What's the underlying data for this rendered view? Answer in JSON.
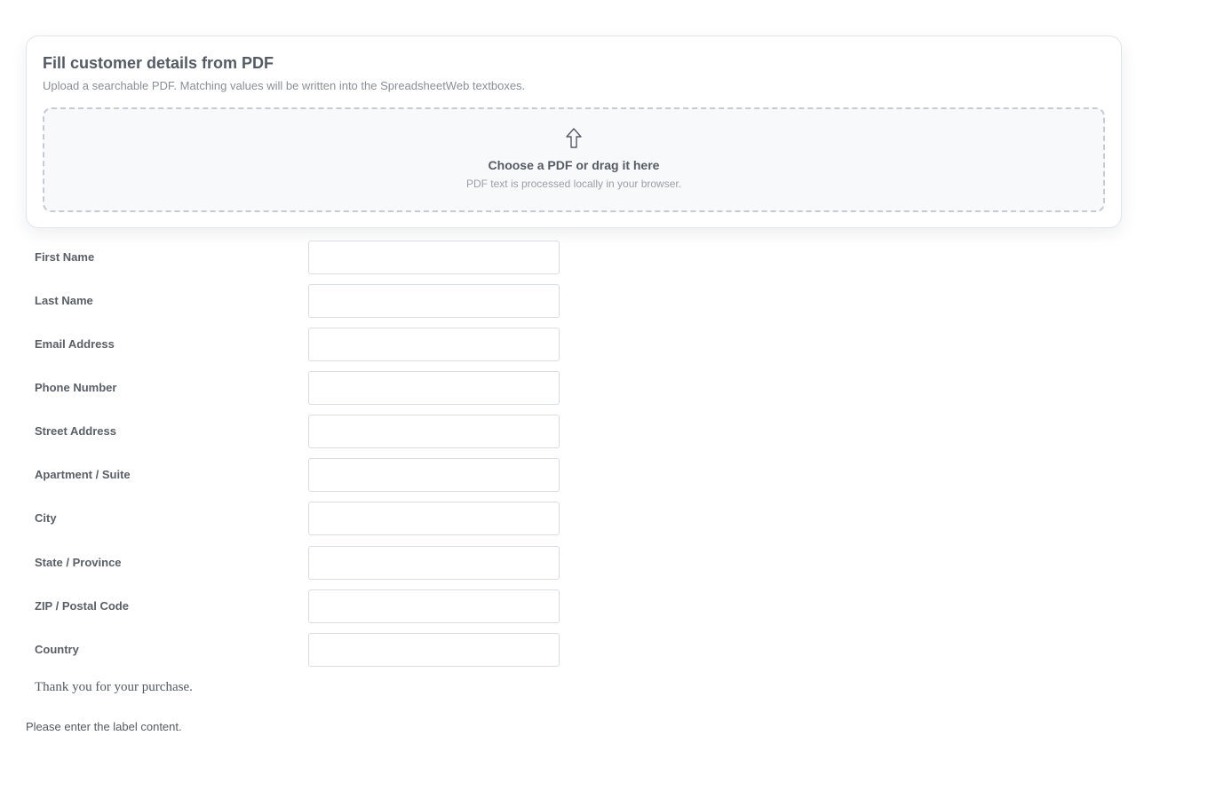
{
  "upload": {
    "title": "Fill customer details from PDF",
    "subtitle": "Upload a searchable PDF. Matching values will be written into the SpreadsheetWeb textboxes.",
    "icon": "upload-arrow-icon",
    "drop_title": "Choose a PDF or drag it here",
    "drop_note": "PDF text is processed locally in your browser."
  },
  "form": {
    "fields": [
      {
        "label": "First Name",
        "value": ""
      },
      {
        "label": "Last Name",
        "value": ""
      },
      {
        "label": "Email Address",
        "value": ""
      },
      {
        "label": "Phone Number",
        "value": ""
      },
      {
        "label": "Street Address",
        "value": ""
      },
      {
        "label": "Apartment / Suite",
        "value": ""
      },
      {
        "label": "City",
        "value": ""
      },
      {
        "label": "State / Province",
        "value": ""
      },
      {
        "label": "ZIP / Postal Code",
        "value": ""
      },
      {
        "label": "Country",
        "value": ""
      }
    ]
  },
  "thanks_text": "Thank you for your purchase.",
  "label_placeholder": "Please enter the label content.",
  "colors": {
    "card_border": "#e2e5ea",
    "dropzone_border": "#c5cad3",
    "dropzone_bg": "#f8f9fb",
    "text_primary": "#555b63",
    "text_muted": "#8a8f96"
  }
}
